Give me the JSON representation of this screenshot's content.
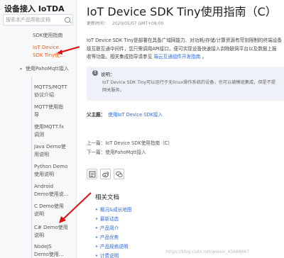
{
  "sidebar": {
    "title": "设备接入 IoTDA",
    "search_placeholder": "搜索本产品帮助文档",
    "items": [
      {
        "label": "SDK使用指南",
        "line2": ""
      },
      {
        "label": "IoT Device",
        "line2": "SDK Tiny使…",
        "active": true
      },
      {
        "label": "使用PahoMqtt接入",
        "line2": ""
      },
      {
        "label": "MQTTS/MQTT",
        "line2": "协议介绍"
      },
      {
        "label": "MQTT使用指",
        "line2": "导"
      },
      {
        "label": "使用MQTT.fx",
        "line2": "调测"
      },
      {
        "label": "Java Demo使",
        "line2": "用说明"
      },
      {
        "label": "Python Demo",
        "line2": "使用说明"
      },
      {
        "label": "Android",
        "line2": "Demo使用说..."
      },
      {
        "label": "C Demo使用",
        "line2": "说明"
      },
      {
        "label": "C# Demo使用",
        "line2": "说明"
      },
      {
        "label": "NodeJS",
        "line2": "Demo使用..."
      }
    ]
  },
  "main": {
    "title": "IoT Device SDK Tiny使用指南（C）",
    "meta_label": "更新时间：",
    "meta_date": "2020/05/07 GMT+08:00",
    "intro_line1": "IoT Device SDK Tiny是部署在具备广域网能力、对功耗/存储/计算资源有苛刻限制的终端设备",
    "intro_line2": "级互联互通中间件，您只需调用API接口，便可实现设备快速接入到物联网平台以及数据上报",
    "intro_line3_pre": "收等功能。相关集成指导请参见 ",
    "intro_link": "端云互通组件开发指南",
    "intro_line3_post": " 。",
    "note_label": "说明：",
    "note_line1": "IoT Device SDK Tiny可以运行于无linux操作系统的设备，也可以被模组集成，但是不提",
    "note_line2": "网关服务。",
    "parent_label": "父主题：",
    "parent_link": "使用IoT Device SDK接入",
    "prev": "上一篇：IoT Device SDK使用指南（C）",
    "next": "下一篇：使用PahoMqtt接入",
    "related_title": "相关文档",
    "related": [
      "概况&成长地图",
      "最新动态",
      "产品简介",
      "产品优势",
      "产品规格说明",
      "计费说明"
    ],
    "watermark": "https://blog.csdn.net/weixin_45688667"
  },
  "colors": {
    "accent": "#ff5a00",
    "link": "#2f6bd8",
    "annotation": "#e01010"
  }
}
